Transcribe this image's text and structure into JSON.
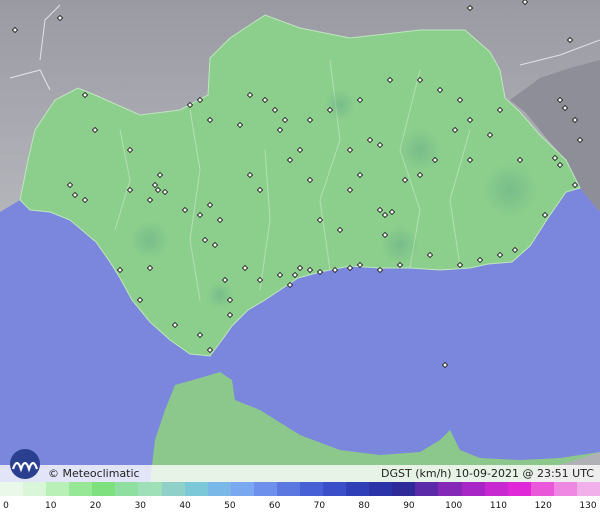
{
  "copyright": "© Meteoclimatic",
  "variable_label": "DGST (km/h)",
  "timestamp": "10-09-2021 @ 23:51 UTC",
  "scale": {
    "labels": [
      "0",
      "10",
      "20",
      "30",
      "40",
      "50",
      "60",
      "70",
      "80",
      "90",
      "100",
      "110",
      "120",
      "130"
    ],
    "min": 0,
    "max": 130,
    "colors": [
      "#eaf8ea",
      "#d9f6d9",
      "#b8f0b8",
      "#96e896",
      "#7ee07e",
      "#8fe0a0",
      "#a0e0b8",
      "#8fd0c8",
      "#7cc8d8",
      "#7ab8e8",
      "#7aa8f0",
      "#6c90ec",
      "#5a78e0",
      "#4860d6",
      "#3a4fc8",
      "#2e3fb8",
      "#2a34a8",
      "#2e2a98",
      "#5a2aa8",
      "#8428b8",
      "#a826c6",
      "#c828d0",
      "#e028d8",
      "#e858d8",
      "#ee88e2",
      "#f2b0ea"
    ]
  },
  "map": {
    "sea_color": "#7b86dd",
    "land_outside_color": "#a8a8b0",
    "region_color": "#8ccf8c",
    "africa_color": "#8cc88c"
  },
  "icons": {
    "logo": "meteoclimatic-logo-icon",
    "station": "station-marker-icon"
  }
}
